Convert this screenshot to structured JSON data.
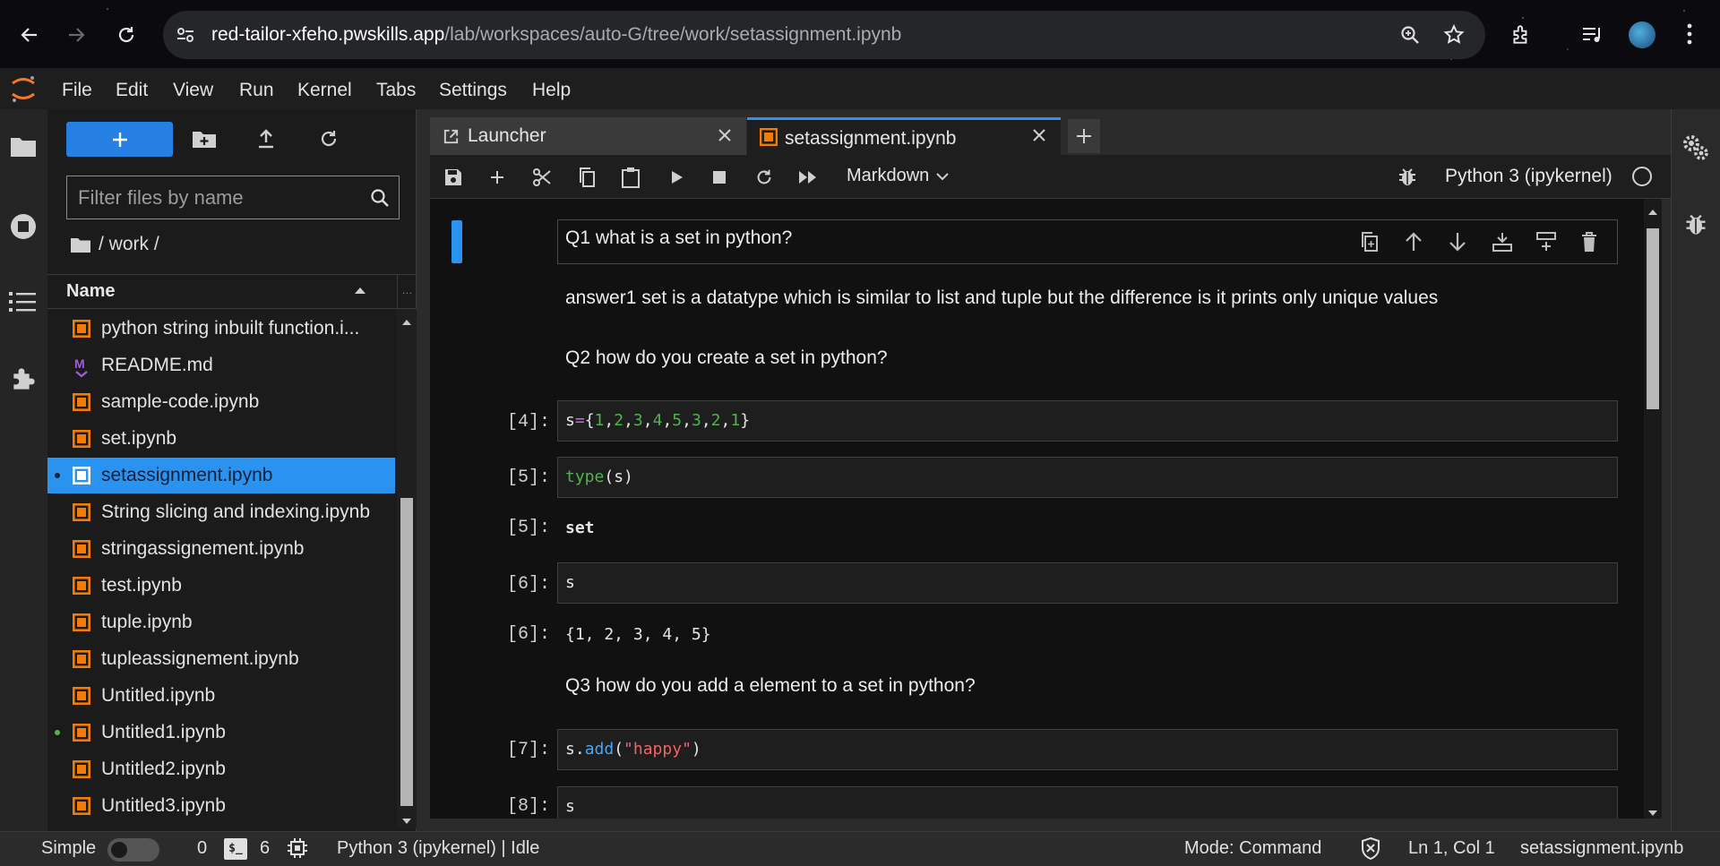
{
  "browser": {
    "url_host": "red-tailor-xfeho.pwskills.app",
    "url_path": "/lab/workspaces/auto-G/tree/work/setassignment.ipynb"
  },
  "menu": [
    "File",
    "Edit",
    "View",
    "Run",
    "Kernel",
    "Tabs",
    "Settings",
    "Help"
  ],
  "file_browser": {
    "filter_placeholder": "Filter files by name",
    "breadcrumb": "/ work /",
    "column_header": "Name",
    "files": [
      {
        "name": "python string inbuilt function.i...",
        "type": "notebook",
        "running": false,
        "selected": false
      },
      {
        "name": "README.md",
        "type": "markdown",
        "running": false,
        "selected": false
      },
      {
        "name": "sample-code.ipynb",
        "type": "notebook",
        "running": false,
        "selected": false
      },
      {
        "name": "set.ipynb",
        "type": "notebook",
        "running": false,
        "selected": false
      },
      {
        "name": "setassignment.ipynb",
        "type": "notebook",
        "running": true,
        "selected": true
      },
      {
        "name": "String slicing and indexing.ipynb",
        "type": "notebook",
        "running": false,
        "selected": false
      },
      {
        "name": "stringassignement.ipynb",
        "type": "notebook",
        "running": false,
        "selected": false
      },
      {
        "name": "test.ipynb",
        "type": "notebook",
        "running": false,
        "selected": false
      },
      {
        "name": "tuple.ipynb",
        "type": "notebook",
        "running": false,
        "selected": false
      },
      {
        "name": "tupleassignement.ipynb",
        "type": "notebook",
        "running": false,
        "selected": false
      },
      {
        "name": "Untitled.ipynb",
        "type": "notebook",
        "running": false,
        "selected": false
      },
      {
        "name": "Untitled1.ipynb",
        "type": "notebook",
        "running": true,
        "selected": false
      },
      {
        "name": "Untitled2.ipynb",
        "type": "notebook",
        "running": false,
        "selected": false
      },
      {
        "name": "Untitled3.ipynb",
        "type": "notebook",
        "running": false,
        "selected": false
      }
    ]
  },
  "tabs": {
    "launcher": "Launcher",
    "notebook": "setassignment.ipynb"
  },
  "toolbar": {
    "cell_type": "Markdown",
    "kernel": "Python 3 (ipykernel)"
  },
  "cells": {
    "q1": "Q1 what is a set in python?",
    "a1": "answer1 set is a datatype which is similar to list and tuple but the difference is it prints only unique values",
    "q2": "Q2 how do you create a set in python?",
    "p4": "[4]:",
    "p5": "[5]:",
    "p5_out": "[5]:",
    "out5": "set",
    "p6": "[6]:",
    "code6": "s",
    "p6_out": "[6]:",
    "out6": "{1, 2, 3, 4, 5}",
    "q3": "Q3 how do you add a element to a set in python?",
    "p7": "[7]:",
    "p8": "[8]:",
    "code8": "s"
  },
  "status": {
    "mode_label": "Simple",
    "terminals": "0",
    "kernels": "6",
    "kernel_status": "Python 3 (ipykernel) | Idle",
    "mode": "Mode: Command",
    "cursor": "Ln 1, Col 1",
    "file": "setassignment.ipynb"
  },
  "colors": {
    "accent": "#2a93f0",
    "brand_orange": "#f57c00",
    "selected_row": "#2a93f0"
  }
}
